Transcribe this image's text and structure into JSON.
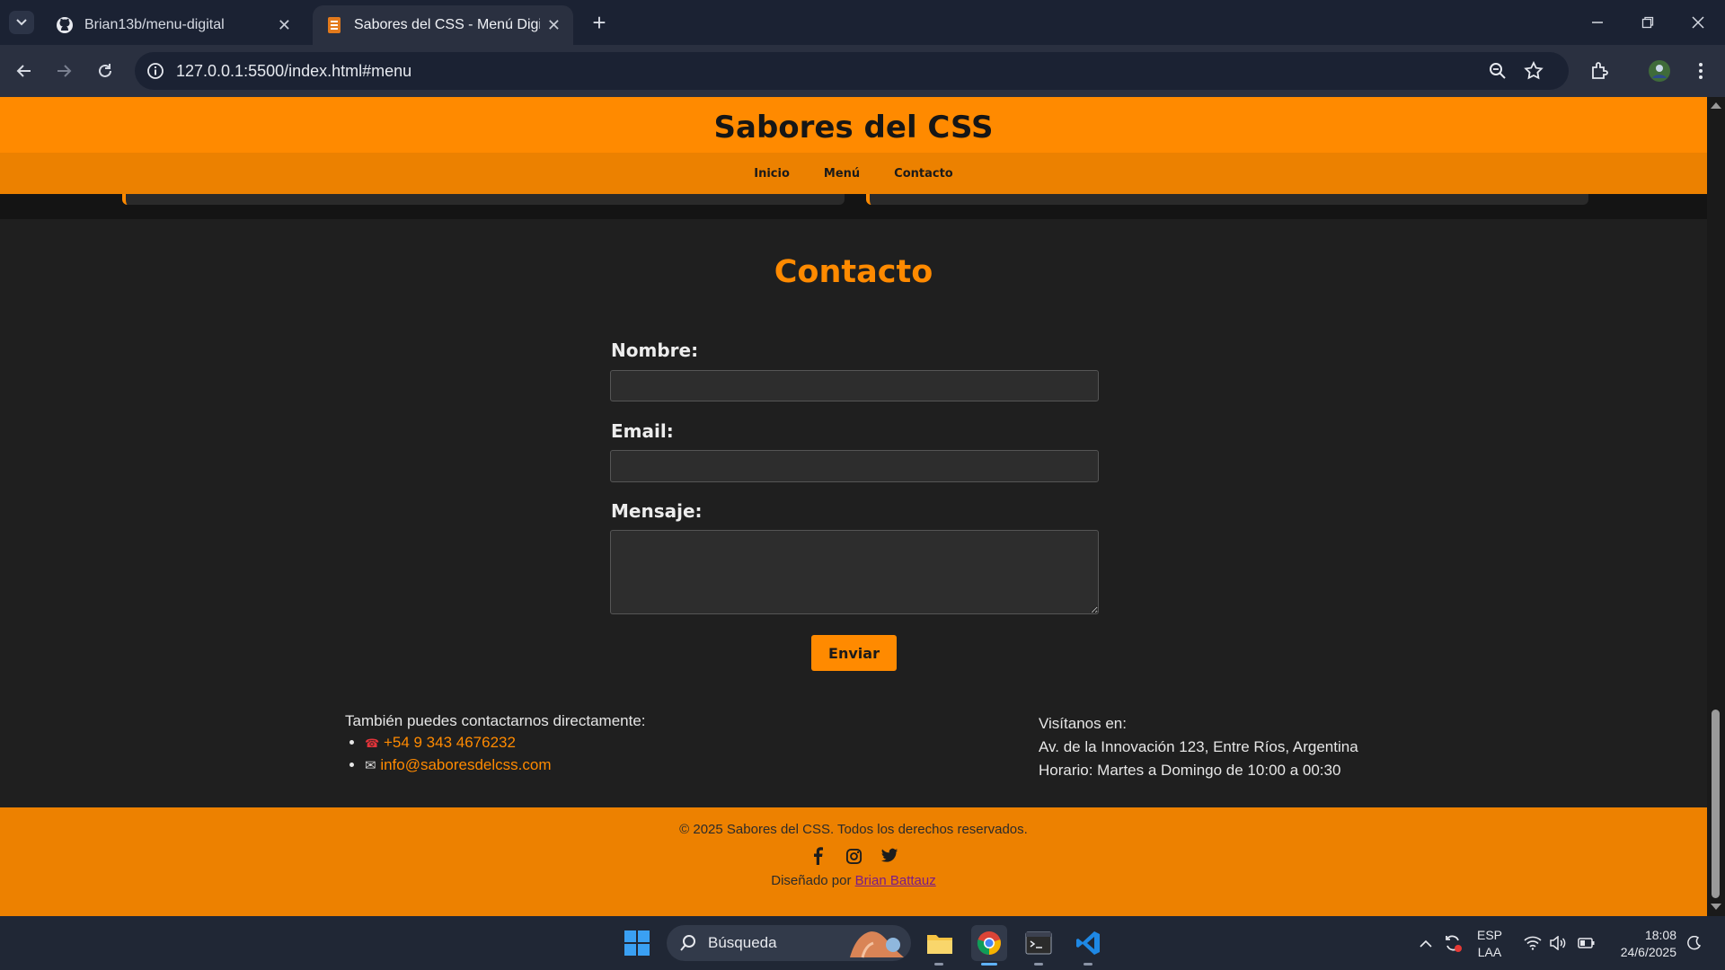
{
  "browser": {
    "tabs": [
      {
        "title": "Brian13b/menu-digital"
      },
      {
        "title": "Sabores del CSS - Menú Digital"
      }
    ],
    "url": "127.0.0.1:5500/index.html#menu"
  },
  "site": {
    "title": "Sabores del CSS",
    "nav": [
      "Inicio",
      "Menú",
      "Contacto"
    ]
  },
  "contact": {
    "title": "Contacto",
    "name_label": "Nombre:",
    "email_label": "Email:",
    "message_label": "Mensaje:",
    "send_label": "Enviar",
    "direct_intro": "También puedes contactarnos directamente:",
    "phone": "+54 9 343 4676232",
    "email": "info@saboresdelcss.com",
    "visit_title": "Visítanos en:",
    "address": "Av. de la Innovación 123, Entre Ríos, Argentina",
    "hours": "Horario: Martes a Domingo de 10:00 a 00:30"
  },
  "footer": {
    "copyright": "© 2025 Sabores del CSS. Todos los derechos reservados.",
    "designed_by": "Diseñado por",
    "author": "Brian Battauz",
    "socials": [
      "facebook-icon",
      "instagram-icon",
      "twitter-icon"
    ]
  },
  "taskbar": {
    "search_label": "Búsqueda",
    "lang_top": "ESP",
    "lang_bottom": "LAA",
    "time": "18:08",
    "date": "24/6/2025"
  },
  "colors": {
    "accent": "#ff8a00",
    "nav_bg": "#ec8100",
    "page_bg": "#1f1f1f",
    "author_link": "#7a1c8a"
  }
}
